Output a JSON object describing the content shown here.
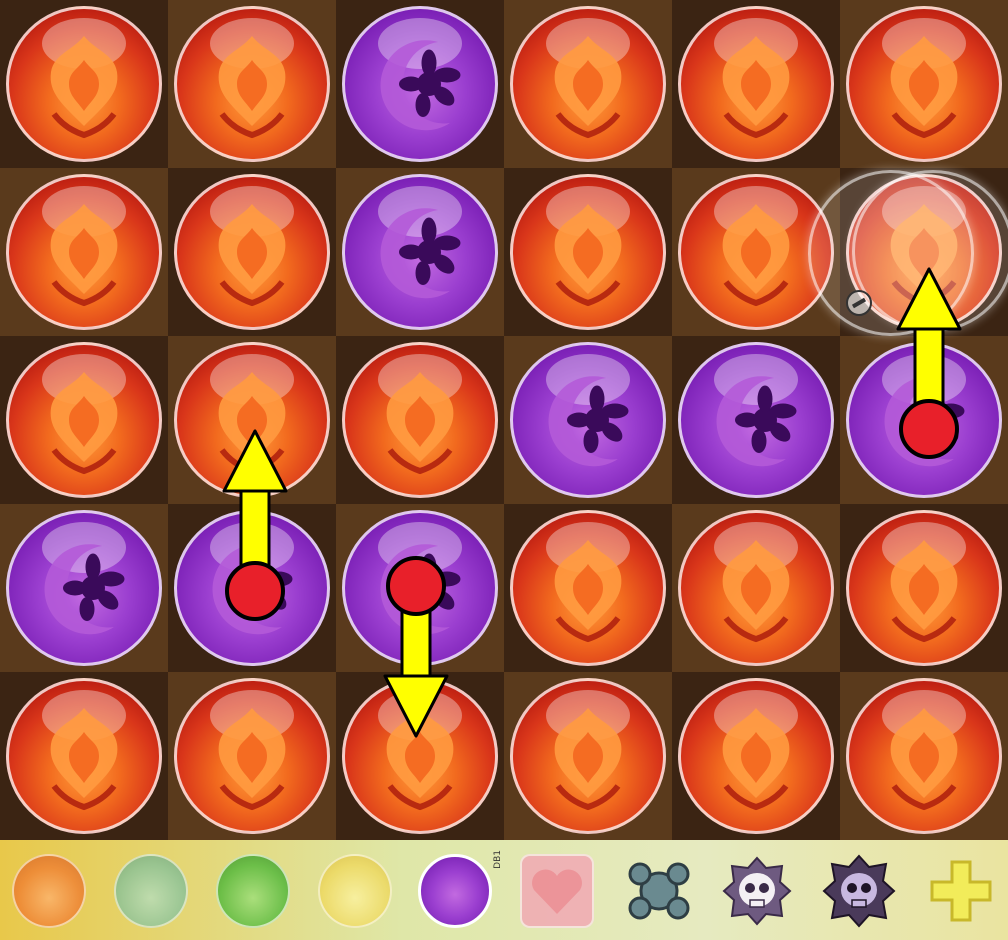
{
  "board": {
    "rows": 5,
    "cols": 6,
    "orbs": [
      [
        "fire",
        "fire",
        "dark",
        "fire",
        "fire",
        "fire"
      ],
      [
        "fire",
        "fire",
        "dark",
        "fire",
        "fire",
        "fire"
      ],
      [
        "fire",
        "fire",
        "fire",
        "dark",
        "dark",
        "dark"
      ],
      [
        "dark",
        "dark",
        "dark",
        "fire",
        "fire",
        "fire"
      ],
      [
        "fire",
        "fire",
        "fire",
        "fire",
        "fire",
        "fire"
      ]
    ]
  },
  "moves": [
    {
      "from": {
        "row": 3,
        "col": 1
      },
      "direction": "up"
    },
    {
      "from": {
        "row": 3,
        "col": 2
      },
      "direction": "down"
    },
    {
      "from": {
        "row": 2,
        "col": 5
      },
      "direction": "up"
    }
  ],
  "toolbar": {
    "orb_palette": [
      "fire-orb-icon",
      "water-orb-icon",
      "wood-orb-icon",
      "light-orb-icon",
      "dark-orb-icon",
      "heart-orb-icon",
      "jammer-orb-icon",
      "poison-orb-icon",
      "mortal-poison-orb-icon",
      "plus-icon"
    ],
    "selected": "dark-orb-icon",
    "tag": "DB1"
  },
  "colors": {
    "arrow": "#ffff00",
    "marker": "#e8202a",
    "fire": "#e0451b",
    "dark": "#9b3fd0"
  }
}
